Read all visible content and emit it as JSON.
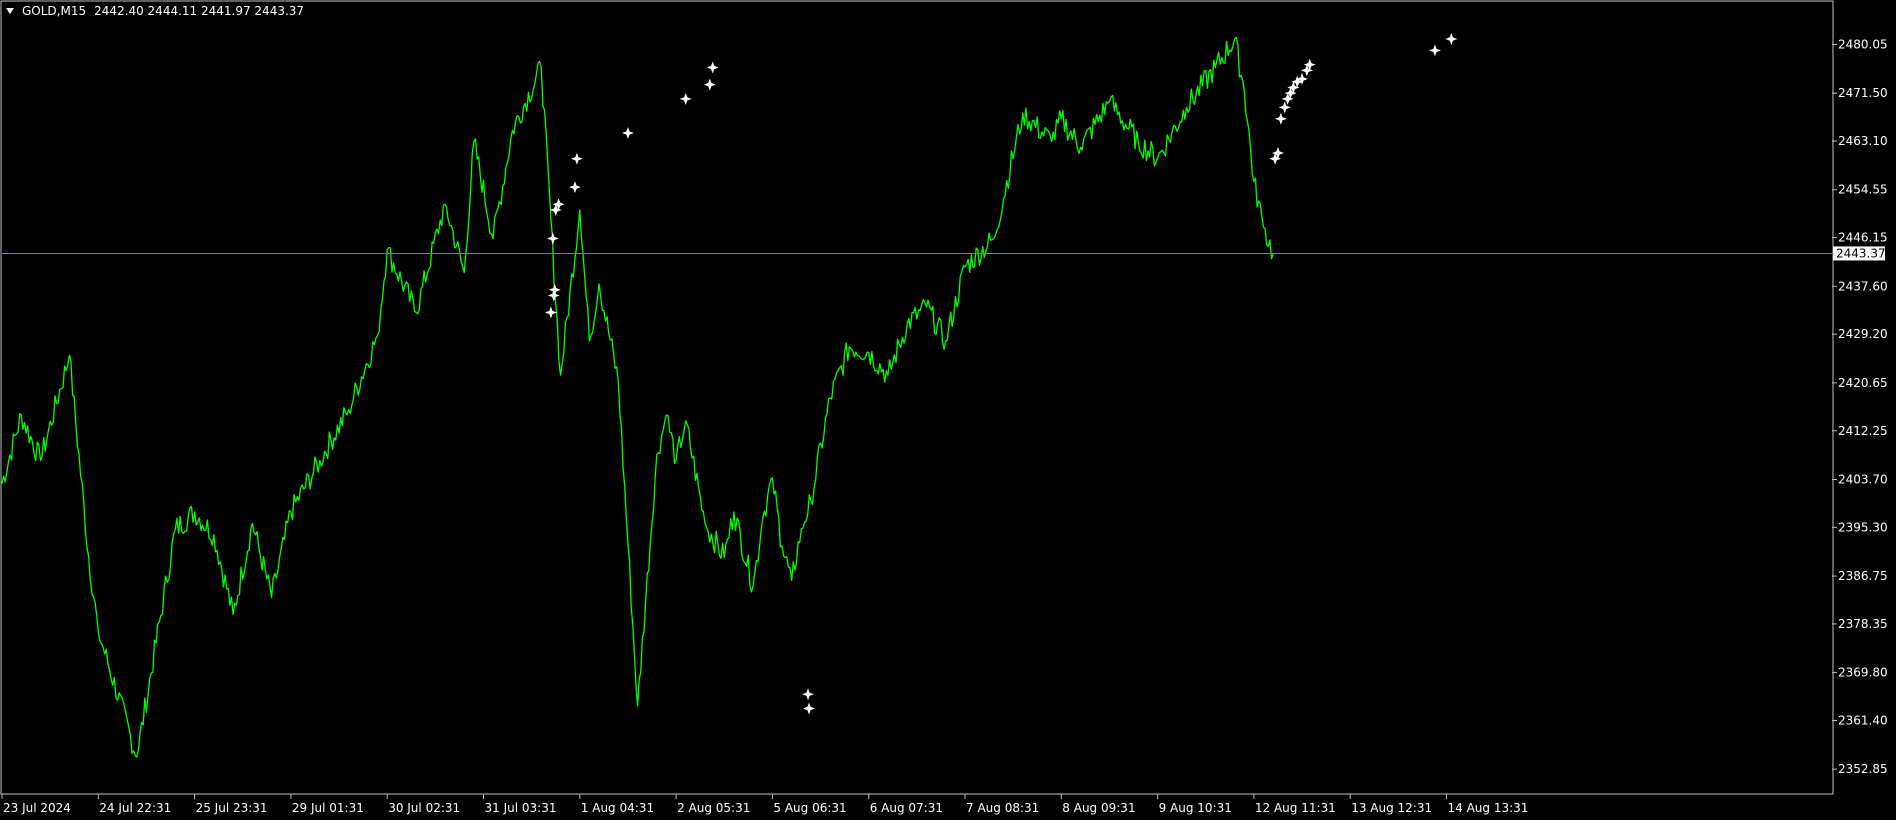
{
  "header": {
    "symbol": "GOLD,M15",
    "ohlc": "2442.40 2444.11 2441.97 2443.37"
  },
  "colors": {
    "background": "#000000",
    "price_line": "#00ff00",
    "grid_frame": "#c0c0c0",
    "text": "#ffffff",
    "current_price_line": "#708090",
    "marker": "#ffffff"
  },
  "chart_data": {
    "type": "line",
    "symbol": "GOLD",
    "timeframe": "M15",
    "current_price": "2443.37",
    "ylim": [
      2348.5,
      2487.5
    ],
    "x_tick_labels": [
      "23 Jul 2024",
      "24 Jul 22:31",
      "25 Jul 23:31",
      "29 Jul 01:31",
      "30 Jul 02:31",
      "31 Jul 03:31",
      "1 Aug 04:31",
      "2 Aug 05:31",
      "5 Aug 06:31",
      "6 Aug 07:31",
      "7 Aug 08:31",
      "8 Aug 09:31",
      "9 Aug 10:31",
      "12 Aug 11:31",
      "13 Aug 12:31",
      "14 Aug 13:31"
    ],
    "y_tick_labels": [
      "2480.05",
      "2471.50",
      "2463.10",
      "2454.55",
      "2446.15",
      "2437.60",
      "2429.20",
      "2420.65",
      "2412.25",
      "2403.70",
      "2395.30",
      "2386.75",
      "2378.35",
      "2369.80",
      "2361.40",
      "2352.85"
    ],
    "x": [
      0,
      0.2,
      0.4,
      0.7,
      0.9,
      1.0,
      1.4,
      1.6,
      1.8,
      2.0,
      2.2,
      2.4,
      2.6,
      2.8,
      3.0,
      3.3,
      3.6,
      3.9,
      4.0,
      4.3,
      4.6,
      4.8,
      4.9,
      5.1,
      5.3,
      5.6,
      5.8,
      6.0,
      6.1,
      6.2,
      6.4,
      6.6,
      6.8,
      6.9,
      7.0,
      7.1,
      7.3,
      7.5,
      7.6,
      7.8,
      7.9,
      8.0,
      8.1,
      8.2,
      8.3,
      8.4,
      8.6,
      8.8,
      9.0,
      9.2,
      9.4,
      9.6,
      9.8,
      10.0,
      10.3,
      10.6,
      10.9,
      11.0,
      11.2,
      11.5,
      11.8,
      12.0,
      12.3,
      12.6,
      12.8,
      12.9,
      13.0,
      13.1,
      13.2,
      13.3,
      13.4,
      13.5,
      13.7,
      13.9,
      14.0,
      14.2,
      14.4,
      14.6,
      14.8,
      14.9,
      15.0,
      15.1,
      15.2,
      15.25
    ],
    "values": [
      2403.0,
      2415.0,
      2407.0,
      2425.5,
      2390.0,
      2377.0,
      2355.0,
      2375.0,
      2395.0,
      2398.0,
      2394.0,
      2380.0,
      2396.0,
      2383.0,
      2398.0,
      2407.0,
      2416.0,
      2429.0,
      2444.0,
      2433.0,
      2452.0,
      2440.0,
      2463.0,
      2446.0,
      2465.0,
      2476.0,
      2422.0,
      2451.0,
      2428.0,
      2438.0,
      2421.0,
      2364.0,
      2408.0,
      2415.0,
      2407.0,
      2414.0,
      2396.0,
      2390.0,
      2398.0,
      2385.0,
      2397.0,
      2404.0,
      2392.0,
      2386.0,
      2395.0,
      2400.0,
      2418.0,
      2427.0,
      2426.0,
      2422.0,
      2431.0,
      2434.0,
      2428.0,
      2441.0,
      2446.0,
      2468.0,
      2463.0,
      2467.0,
      2462.0,
      2470.0,
      2463.0,
      2460.0,
      2469.0,
      2476.0,
      2481.0,
      2472.0,
      2456.0,
      2448.0,
      2443.37
    ],
    "markers": [
      {
        "x": 5.75,
        "y": 2451.0
      },
      {
        "x": 5.78,
        "y": 2452.0
      },
      {
        "x": 5.72,
        "y": 2446.0
      },
      {
        "x": 5.74,
        "y": 2437.0
      },
      {
        "x": 5.73,
        "y": 2436.0
      },
      {
        "x": 5.7,
        "y": 2433.0
      },
      {
        "x": 5.95,
        "y": 2455.0
      },
      {
        "x": 5.97,
        "y": 2460.0
      },
      {
        "x": 6.5,
        "y": 2464.5
      },
      {
        "x": 7.1,
        "y": 2470.5
      },
      {
        "x": 7.38,
        "y": 2476.0
      },
      {
        "x": 7.35,
        "y": 2473.0
      },
      {
        "x": 8.37,
        "y": 2366.0
      },
      {
        "x": 8.38,
        "y": 2363.5
      },
      {
        "x": 13.25,
        "y": 2461.0
      },
      {
        "x": 13.22,
        "y": 2460.0
      },
      {
        "x": 13.28,
        "y": 2467.0
      },
      {
        "x": 13.32,
        "y": 2469.0
      },
      {
        "x": 13.35,
        "y": 2470.5
      },
      {
        "x": 13.38,
        "y": 2471.5
      },
      {
        "x": 13.41,
        "y": 2472.5
      },
      {
        "x": 13.45,
        "y": 2473.5
      },
      {
        "x": 13.5,
        "y": 2474.0
      },
      {
        "x": 13.55,
        "y": 2475.5
      },
      {
        "x": 13.58,
        "y": 2476.5
      },
      {
        "x": 14.88,
        "y": 2479.0
      },
      {
        "x": 15.05,
        "y": 2481.0
      }
    ],
    "grid": false,
    "legend": "none"
  }
}
